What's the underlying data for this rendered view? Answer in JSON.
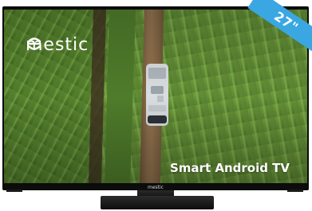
{
  "brand": {
    "name": "mestic",
    "chin_logo": "mestic"
  },
  "screen": {
    "tagline": "Smart Android TV"
  },
  "badge": {
    "size_label": "27\""
  },
  "colors": {
    "bezel": "#0c0c0c",
    "badge": "#3aa7e2",
    "field_green": "#5f8f2e",
    "path_brown": "#8a6a4a"
  }
}
